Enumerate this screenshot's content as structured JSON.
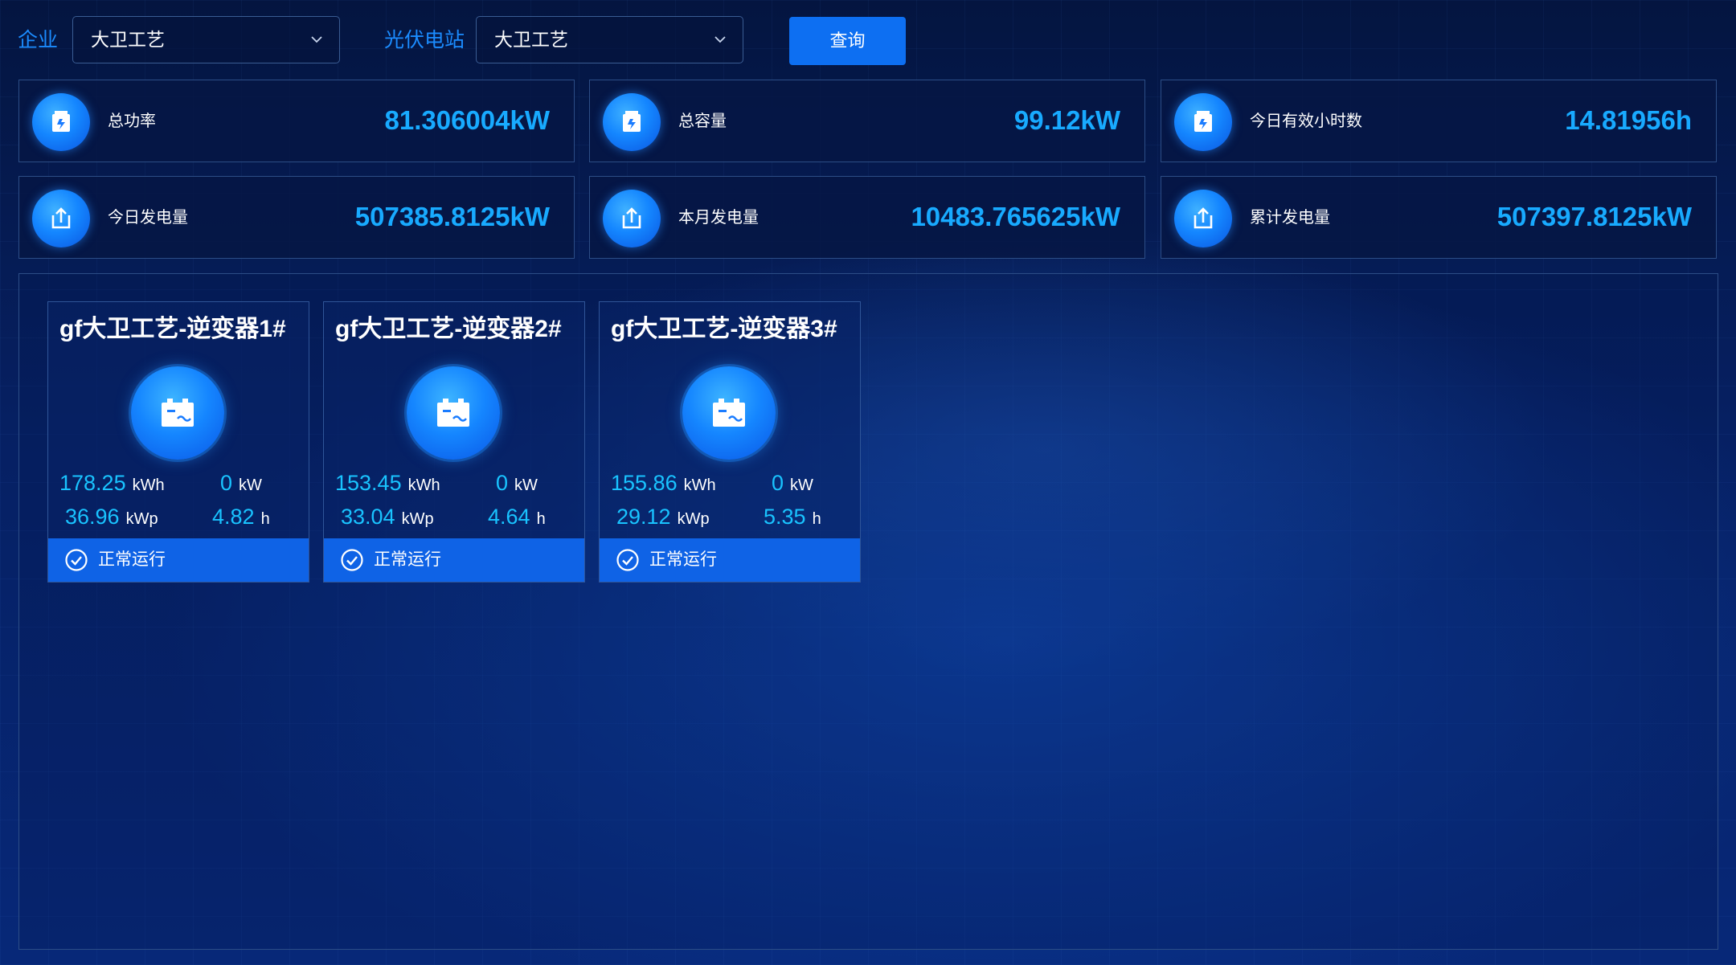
{
  "filters": {
    "enterprise_label": "企业",
    "enterprise_value": "大卫工艺",
    "station_label": "光伏电站",
    "station_value": "大卫工艺",
    "query_label": "查询"
  },
  "stats": [
    {
      "label": "总功率",
      "value": "81.306004kW",
      "icon": "storage-icon"
    },
    {
      "label": "总容量",
      "value": "99.12kW",
      "icon": "storage-icon"
    },
    {
      "label": "今日有效小时数",
      "value": "14.81956h",
      "icon": "storage-icon"
    },
    {
      "label": "今日发电量",
      "value": "507385.8125kW",
      "icon": "upload-icon"
    },
    {
      "label": "本月发电量",
      "value": "10483.765625kW",
      "icon": "upload-icon"
    },
    {
      "label": "累计发电量",
      "value": "507397.8125kW",
      "icon": "upload-icon"
    }
  ],
  "inverters": [
    {
      "title": "gf大卫工艺-逆变器1#",
      "energy": "178.25",
      "energy_unit": "kWh",
      "power": "0",
      "power_unit": "kW",
      "capacity": "36.96",
      "capacity_unit": "kWp",
      "hours": "4.82",
      "hours_unit": "h",
      "status": "正常运行"
    },
    {
      "title": "gf大卫工艺-逆变器2#",
      "energy": "153.45",
      "energy_unit": "kWh",
      "power": "0",
      "power_unit": "kW",
      "capacity": "33.04",
      "capacity_unit": "kWp",
      "hours": "4.64",
      "hours_unit": "h",
      "status": "正常运行"
    },
    {
      "title": "gf大卫工艺-逆变器3#",
      "energy": "155.86",
      "energy_unit": "kWh",
      "power": "0",
      "power_unit": "kW",
      "capacity": "29.12",
      "capacity_unit": "kWp",
      "hours": "5.35",
      "hours_unit": "h",
      "status": "正常运行"
    }
  ],
  "colors": {
    "accent": "#1b8cff",
    "value": "#18aaff",
    "metric": "#19c3ff",
    "status_bar": "#0f63e6"
  }
}
